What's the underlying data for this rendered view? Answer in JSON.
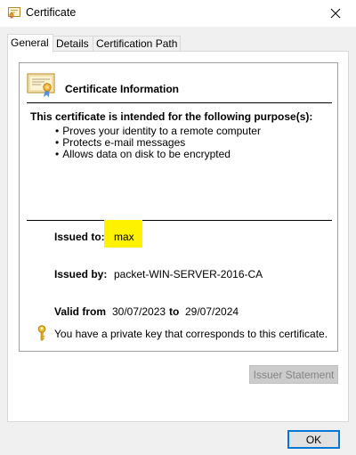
{
  "window": {
    "title": "Certificate"
  },
  "tabs": [
    {
      "label": "General",
      "active": true
    },
    {
      "label": "Details",
      "active": false
    },
    {
      "label": "Certification Path",
      "active": false
    }
  ],
  "cert_info": {
    "heading": "Certificate Information",
    "purpose_heading": "This certificate is intended for the following purpose(s):",
    "purposes": [
      "Proves your identity to a remote computer",
      "Protects e-mail messages",
      "Allows data on disk to be encrypted"
    ]
  },
  "issued_to": {
    "label": "Issued to:",
    "value": "max"
  },
  "issued_by": {
    "label": "Issued by:",
    "value": "packet-WIN-SERVER-2016-CA"
  },
  "validity": {
    "from_label": "Valid from",
    "from_value": "30/07/2023",
    "to_label": "to",
    "to_value": "29/07/2024"
  },
  "private_key_note": "You have a private key that corresponds to this certificate.",
  "buttons": {
    "issuer_statement": "Issuer Statement",
    "ok": "OK"
  },
  "colors": {
    "highlight": "#fff200",
    "focus_border": "#0078d7",
    "disabled_text": "#838383"
  },
  "icons": [
    "certificate-icon",
    "close-icon",
    "certificate-badge-icon",
    "key-icon"
  ]
}
